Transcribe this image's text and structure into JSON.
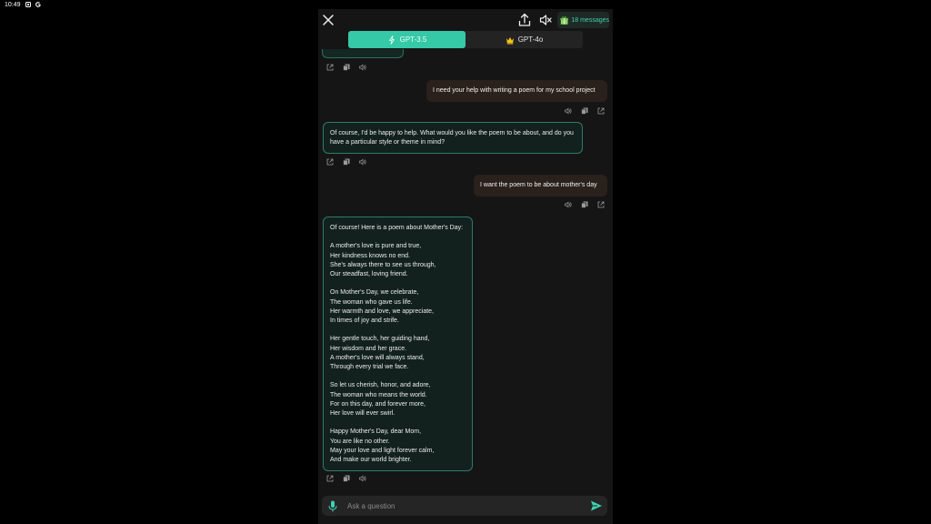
{
  "status_bar": {
    "time": "10:49"
  },
  "header": {
    "message_count": "18 messages"
  },
  "model_switch": {
    "tabs": [
      {
        "label": "GPT-3.5",
        "active": true
      },
      {
        "label": "GPT-4o",
        "active": false
      }
    ]
  },
  "messages": [
    {
      "role": "user",
      "text": "I need your help with writing a poem for my school project"
    },
    {
      "role": "assistant",
      "text": "Of course, I'd be happy to help. What would you like the poem to be about, and do you have a particular style or theme in mind?"
    },
    {
      "role": "user",
      "text": "I want the poem to be about mother's day"
    },
    {
      "role": "assistant",
      "text": "Of course! Here is a poem about Mother's Day:\n\nA mother's love is pure and true,\nHer kindness knows no end.\nShe's always there to see us through,\nOur steadfast, loving friend.\n\nOn Mother's Day, we celebrate,\nThe woman who gave us life.\nHer warmth and love, we appreciate,\nIn times of joy and strife.\n\nHer gentle touch, her guiding hand,\nHer wisdom and her grace.\nA mother's love will always stand,\nThrough every trial we face.\n\nSo let us cherish, honor, and adore,\nThe woman who means the world.\nFor on this day, and forever more,\nHer love will ever swirl.\n\nHappy Mother's Day, dear Mom,\nYou are like no other.\nMay your love and light forever calm,\nAnd make our world brighter."
    }
  ],
  "input": {
    "placeholder": "Ask a question"
  },
  "colors": {
    "accent": "#35c9a8",
    "bot_border": "#2e7c68",
    "user_bubble": "#2a201c",
    "background": "#151515"
  },
  "icons": [
    "close-icon",
    "share-icon",
    "volume-mute-icon",
    "gift-icon",
    "spark-icon",
    "crown-icon",
    "external-link-icon",
    "copy-icon",
    "speaker-icon",
    "mic-icon",
    "send-icon"
  ]
}
